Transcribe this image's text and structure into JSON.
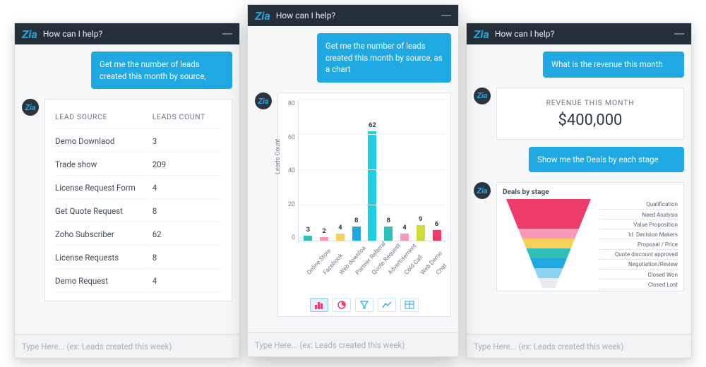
{
  "header_title": "How can I help?",
  "logo_text": "Zia",
  "avatar_text": "Zia",
  "input_placeholder": "Type Here... (ex: Leads created this week)",
  "panel_left": {
    "user_msg": "Get me the number of leads created this month by source,",
    "table": {
      "col1": "LEAD SOURCE",
      "col2": "LEADS COUNT",
      "rows": [
        {
          "source": "Demo Downlaod",
          "count": "3"
        },
        {
          "source": "Trade show",
          "count": "209"
        },
        {
          "source": "License Request Form",
          "count": "4"
        },
        {
          "source": "Get Quote Request",
          "count": "8"
        },
        {
          "source": "Zoho Subscriber",
          "count": "62"
        },
        {
          "source": "License Requests",
          "count": "8"
        },
        {
          "source": "Demo Request",
          "count": "4"
        }
      ]
    }
  },
  "panel_mid": {
    "user_msg": "Get me the number of leads created this month by source, as a chart",
    "toolbar": {
      "bar": "bar",
      "pie": "pie",
      "funnel": "funnel",
      "line": "line",
      "table": "table"
    }
  },
  "panel_right": {
    "user_msg1": "What is the revenue this month",
    "kpi_label": "REVENUE THIS MONTH",
    "kpi_value": "$400,000",
    "user_msg2": "Show me the Deals by each stage",
    "funnel": {
      "title": "Deals by stage",
      "stages": [
        "Qualification",
        "Need Analysis",
        "Value Proposition",
        "Id. Decision Makers",
        "Proposal / Price",
        "Quote discount approved",
        "Negotiation/Review",
        "Closed Won",
        "Closed Lost"
      ],
      "colors": [
        "#ed3b6a",
        "#ed3b6a",
        "#ed3b6a",
        "#f79ab6",
        "#f6d15a",
        "#2fc0b8",
        "#1fa8e2",
        "#8fd3f4",
        "#e6ebef"
      ]
    }
  },
  "chart_data": {
    "type": "bar",
    "ylabel": "Leads Count",
    "ylim": [
      0,
      80
    ],
    "yticks": [
      0,
      20,
      40,
      60,
      80
    ],
    "categories": [
      "Online Store",
      "Facebook",
      "Web downloa",
      "Partner Referral",
      "Quote Request",
      "Advertisement",
      "Cold Call",
      "Web Demo",
      "Chat"
    ],
    "values": [
      3,
      2,
      4,
      8,
      62,
      8,
      4,
      9,
      6
    ],
    "colors": [
      "#2fc0b8",
      "#f79ab6",
      "#f6d15a",
      "#1fa8e2",
      "#1fd0e2",
      "#2fc0b8",
      "#f79ab6",
      "#cddc39",
      "#ed3b6a"
    ]
  }
}
